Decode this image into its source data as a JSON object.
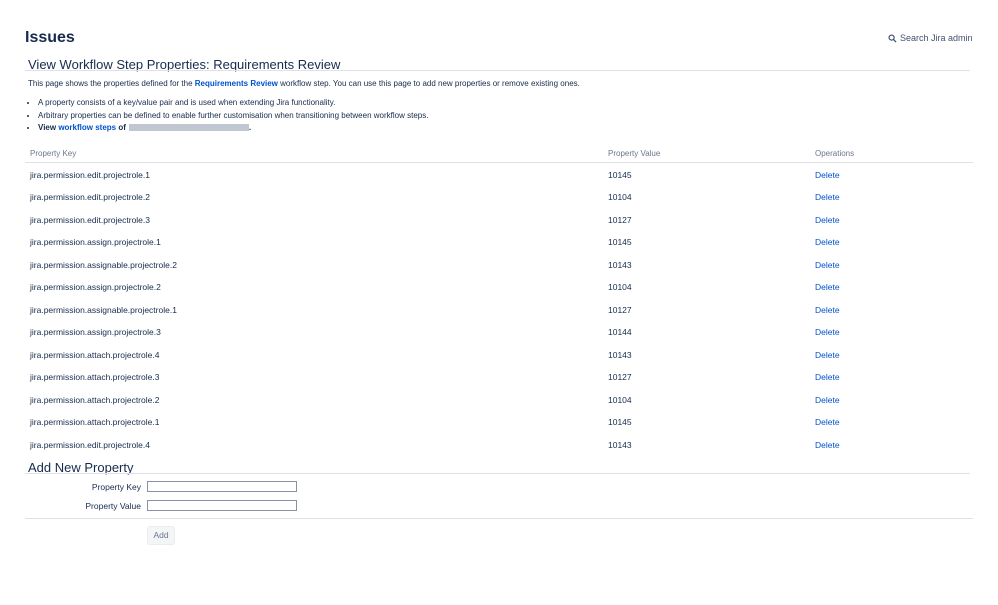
{
  "header": {
    "title": "Issues",
    "search_label": "Search Jira admin"
  },
  "section": {
    "title": "View Workflow Step Properties: Requirements Review",
    "intro_prefix": "This page shows the properties defined for the ",
    "intro_step": "Requirements Review",
    "intro_suffix": " workflow step. You can use this page to add new properties or remove existing ones.",
    "bullets": [
      "A property consists of a key/value pair and is used when extending Jira functionality.",
      "Arbitrary properties can be defined to enable further customisation when transitioning between workflow steps."
    ],
    "view_prefix": "View ",
    "view_link": "workflow steps",
    "view_of": " of",
    "view_end": "."
  },
  "table": {
    "headers": {
      "key": "Property Key",
      "value": "Property Value",
      "operations": "Operations"
    },
    "rows": [
      {
        "key": "jira.permission.edit.projectrole.1",
        "value": "10145",
        "op": "Delete"
      },
      {
        "key": "jira.permission.edit.projectrole.2",
        "value": "10104",
        "op": "Delete"
      },
      {
        "key": "jira.permission.edit.projectrole.3",
        "value": "10127",
        "op": "Delete"
      },
      {
        "key": "jira.permission.assign.projectrole.1",
        "value": "10145",
        "op": "Delete"
      },
      {
        "key": "jira.permission.assignable.projectrole.2",
        "value": "10143",
        "op": "Delete"
      },
      {
        "key": "jira.permission.assign.projectrole.2",
        "value": "10104",
        "op": "Delete"
      },
      {
        "key": "jira.permission.assignable.projectrole.1",
        "value": "10127",
        "op": "Delete"
      },
      {
        "key": "jira.permission.assign.projectrole.3",
        "value": "10144",
        "op": "Delete"
      },
      {
        "key": "jira.permission.attach.projectrole.4",
        "value": "10143",
        "op": "Delete"
      },
      {
        "key": "jira.permission.attach.projectrole.3",
        "value": "10127",
        "op": "Delete"
      },
      {
        "key": "jira.permission.attach.projectrole.2",
        "value": "10104",
        "op": "Delete"
      },
      {
        "key": "jira.permission.attach.projectrole.1",
        "value": "10145",
        "op": "Delete"
      },
      {
        "key": "jira.permission.edit.projectrole.4",
        "value": "10143",
        "op": "Delete"
      }
    ]
  },
  "add_form": {
    "title": "Add New Property",
    "key_label": "Property Key",
    "key_value": "",
    "value_label": "Property Value",
    "value_value": "",
    "submit_label": "Add"
  },
  "icons": {
    "search": "search-icon"
  },
  "colors": {
    "link": "#0052cc",
    "text": "#172b4d",
    "muted": "#6b778c",
    "redacted": "#c1c7d0"
  }
}
